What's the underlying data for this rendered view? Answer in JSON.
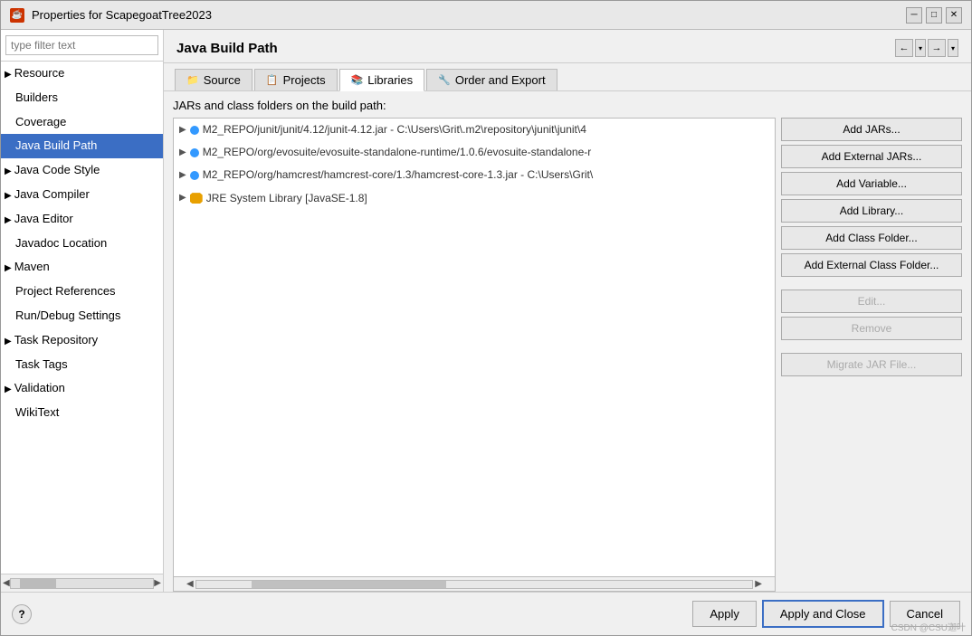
{
  "titleBar": {
    "icon": "☕",
    "title": "Properties for ScapegoatTree2023",
    "minimize": "─",
    "maximize": "□",
    "close": "✕"
  },
  "sidebar": {
    "searchPlaceholder": "type filter text",
    "items": [
      {
        "label": "Resource",
        "hasArrow": true,
        "selected": false
      },
      {
        "label": "Builders",
        "hasArrow": false,
        "selected": false
      },
      {
        "label": "Coverage",
        "hasArrow": false,
        "selected": false
      },
      {
        "label": "Java Build Path",
        "hasArrow": false,
        "selected": true
      },
      {
        "label": "Java Code Style",
        "hasArrow": true,
        "selected": false
      },
      {
        "label": "Java Compiler",
        "hasArrow": true,
        "selected": false
      },
      {
        "label": "Java Editor",
        "hasArrow": true,
        "selected": false
      },
      {
        "label": "Javadoc Location",
        "hasArrow": false,
        "selected": false
      },
      {
        "label": "Maven",
        "hasArrow": true,
        "selected": false
      },
      {
        "label": "Project References",
        "hasArrow": false,
        "selected": false
      },
      {
        "label": "Run/Debug Settings",
        "hasArrow": false,
        "selected": false
      },
      {
        "label": "Task Repository",
        "hasArrow": true,
        "selected": false
      },
      {
        "label": "Task Tags",
        "hasArrow": false,
        "selected": false
      },
      {
        "label": "Validation",
        "hasArrow": true,
        "selected": false
      },
      {
        "label": "WikiText",
        "hasArrow": false,
        "selected": false
      }
    ]
  },
  "panel": {
    "title": "Java Build Path"
  },
  "tabs": [
    {
      "label": "Source",
      "icon": "📁",
      "active": false
    },
    {
      "label": "Projects",
      "icon": "📋",
      "active": false
    },
    {
      "label": "Libraries",
      "icon": "📚",
      "active": true
    },
    {
      "label": "Order and Export",
      "icon": "🔧",
      "active": false
    }
  ],
  "buildPath": {
    "label": "JARs and class folders on the build path:",
    "items": [
      {
        "type": "dot",
        "text": "M2_REPO/junit/junit/4.12/junit-4.12.jar - C:\\Users\\Grit\\.m2\\repository\\junit\\junit\\4"
      },
      {
        "type": "dot",
        "text": "M2_REPO/org/evosuite/evosuite-standalone-runtime/1.0.6/evosuite-standalone-r"
      },
      {
        "type": "dot",
        "text": "M2_REPO/org/hamcrest/hamcrest-core/1.3/hamcrest-core-1.3.jar - C:\\Users\\Grit\\"
      },
      {
        "type": "jre",
        "text": "JRE System Library [JavaSE-1.8]"
      }
    ]
  },
  "buttons": {
    "addJars": "Add JARs...",
    "addExternalJars": "Add External JARs...",
    "addVariable": "Add Variable...",
    "addLibrary": "Add Library...",
    "addClassFolder": "Add Class Folder...",
    "addExternalClassFolder": "Add External Class Folder...",
    "edit": "Edit...",
    "remove": "Remove",
    "migrateJar": "Migrate JAR File..."
  },
  "bottomBar": {
    "apply": "Apply",
    "applyAndClose": "Apply and Close",
    "cancel": "Cancel"
  },
  "footer": "CSDN @CSU迦叶"
}
